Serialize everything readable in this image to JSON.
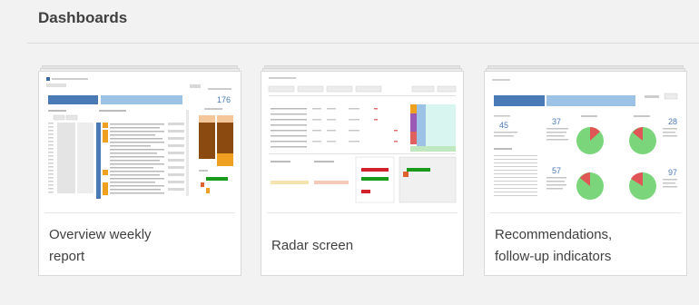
{
  "header": {
    "title": "Dashboards"
  },
  "cards": [
    {
      "title_line1": "Overview weekly",
      "title_line2": "report",
      "kpi": "176"
    },
    {
      "title_line1": "Radar screen",
      "title_line2": ""
    },
    {
      "title_line1": "Recommendations,",
      "title_line2": "follow-up indicators",
      "kpis": [
        "45",
        "37",
        "28",
        "57",
        "97"
      ]
    }
  ],
  "colors": {
    "blue": "#4a7ab5",
    "lightblue": "#9cc3e6",
    "orange": "#f0a020",
    "brown": "#8b4a10",
    "green": "#7bd67b",
    "red": "#e05555"
  }
}
